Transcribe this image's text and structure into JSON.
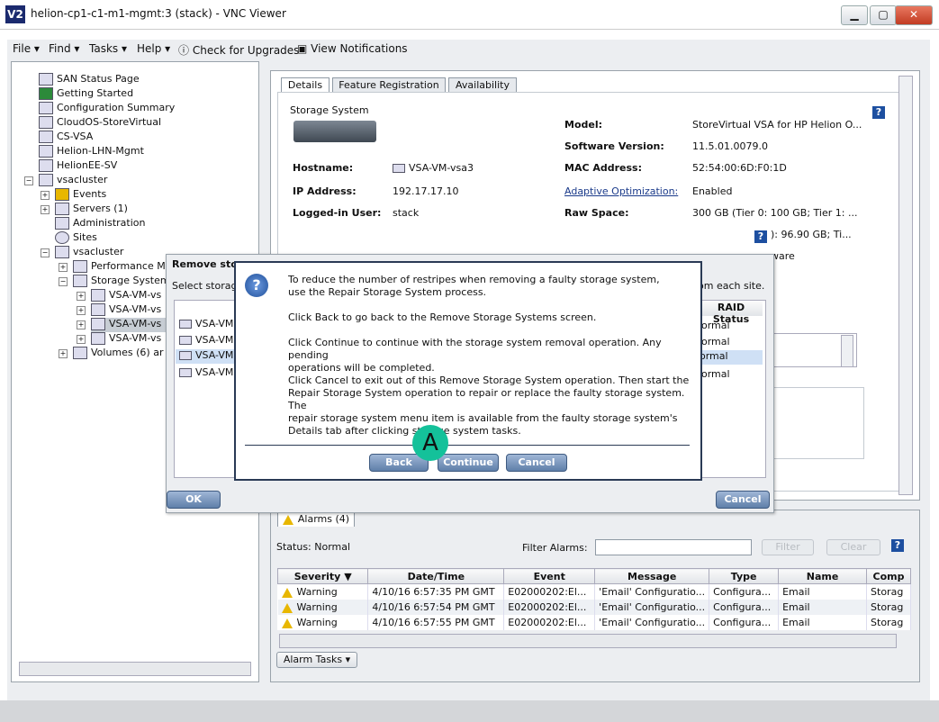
{
  "window": {
    "title": "helion-cp1-c1-m1-mgmt:3 (stack) - VNC Viewer",
    "icon_text": "V2",
    "minimize": "▁",
    "restore": "▢",
    "close": "✕"
  },
  "menu": {
    "file": "File",
    "find": "Find",
    "tasks": "Tasks",
    "help": "Help",
    "upgrades": "Check for Upgrades",
    "notifications": "View Notifications"
  },
  "tree": {
    "items": [
      "SAN Status Page",
      "Getting Started",
      "Configuration Summary",
      "CloudOS-StoreVirtual",
      "CS-VSA",
      "Helion-LHN-Mgmt",
      "HelionEE-SV",
      "vsacluster",
      "Events",
      "Servers (1)",
      "Administration",
      "Sites",
      "vsacluster",
      "Performance M",
      "Storage System",
      "VSA-VM-vs",
      "VSA-VM-vs",
      "VSA-VM-vs",
      "VSA-VM-vs",
      "Volumes (6) ar"
    ]
  },
  "tabs": {
    "details": "Details",
    "feature": "Feature Registration",
    "availability": "Availability"
  },
  "storage": {
    "group_label": "Storage System",
    "hostname_label": "Hostname:",
    "hostname": "VSA-VM-vsa3",
    "ip_label": "IP Address:",
    "ip": "192.17.17.10",
    "user_label": "Logged-in User:",
    "user": "stack",
    "model_label": "Model:",
    "model": "StoreVirtual VSA for HP Helion O...",
    "software_label": "Software Version:",
    "software": "11.5.01.0079.0",
    "mac_label": "MAC Address:",
    "mac": "52:54:00:6D:F0:1D",
    "adaptive_label": "Adaptive Optimization:",
    "adaptive": "Enabled",
    "raw_label": "Raw Space:",
    "raw": "300 GB (Tier 0: 100 GB; Tier 1: ...",
    "usable_partial": "): 96.90 GB; Ti...",
    "hardware_partial": "ware"
  },
  "alarms": {
    "tab": "Alarms (4)",
    "status_label": "Status:",
    "status": "Normal",
    "filter_label": "Filter Alarms:",
    "filter_value": "",
    "filter_btn": "Filter",
    "clear_btn": "Clear",
    "columns": [
      "Severity",
      "Date/Time",
      "Event",
      "Message",
      "Type",
      "Name",
      "Comp"
    ],
    "rows": [
      [
        "Warning",
        "4/10/16 6:57:35 PM GMT",
        "E02000202:El...",
        "'Email' Configuratio...",
        "Configura...",
        "Email",
        "Storag"
      ],
      [
        "Warning",
        "4/10/16 6:57:54 PM GMT",
        "E02000202:El...",
        "'Email' Configuratio...",
        "Configura...",
        "Email",
        "Storag"
      ],
      [
        "Warning",
        "4/10/16 6:57:55 PM GMT",
        "E02000202:El...",
        "'Email' Configuratio...",
        "Configura...",
        "Email",
        "Storag"
      ]
    ],
    "tasks_btn": "Alarm Tasks"
  },
  "remove_dialog": {
    "title": "Remove stor",
    "subtitle": "Select storag",
    "site_text": "om each site.",
    "raid_header": "RAID Status",
    "list": [
      "VSA-VM",
      "VSA-VM",
      "VSA-VM",
      "VSA-VM"
    ],
    "raid": [
      "ormal",
      "ormal",
      "ormal",
      "ormal"
    ],
    "ok": "OK",
    "cancel": "Cancel"
  },
  "confirm": {
    "icon": "?",
    "p1a": "To reduce the number of restripes when removing a faulty storage system,",
    "p1b": "use the Repair Storage System process.",
    "p2": "Click Back to go back to the Remove Storage Systems screen.",
    "p3a": "Click Continue to continue with the storage system removal operation. Any pending",
    "p3b": "operations will be completed.",
    "p4a": "Click Cancel to exit out of this Remove Storage System operation. Then start the",
    "p4b": "Repair Storage System operation to repair or replace the faulty storage system. The",
    "p4c": "repair storage system menu item is available from the faulty storage system's",
    "p4d": "Details tab after clicking storage system tasks.",
    "back": "Back",
    "continue": "Continue",
    "cancel": "Cancel"
  },
  "callout": "A"
}
